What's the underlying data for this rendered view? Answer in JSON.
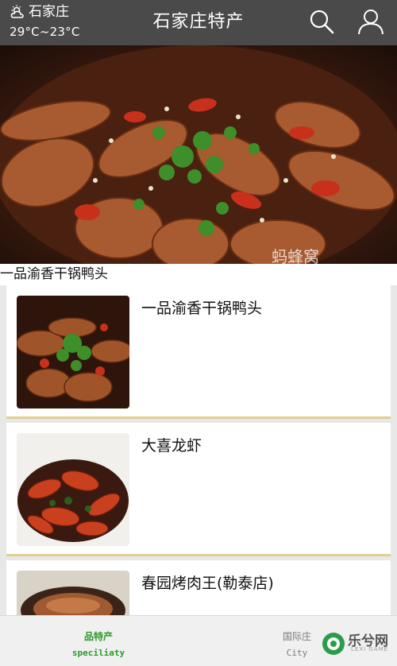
{
  "header": {
    "city": "石家庄",
    "temperature": "29°C~23°C",
    "title": "石家庄特产",
    "weather_icon": "cloud-sun-icon",
    "search_icon": "search-icon",
    "user_icon": "user-icon"
  },
  "hero": {
    "caption": "一品渝香干锅鸭头",
    "watermark": "蚂蜂窝"
  },
  "list": {
    "items": [
      {
        "name": "一品渝香干锅鸭头"
      },
      {
        "name": "大喜龙虾"
      },
      {
        "name": "春园烤肉王(勒泰店)"
      }
    ]
  },
  "bottom_nav": {
    "tabs": [
      {
        "label": "品特产",
        "sub": "speciliaty",
        "active": true
      },
      {
        "label": "国际庄",
        "sub": "City",
        "active": false
      }
    ]
  },
  "watermark": {
    "text": "乐兮网",
    "sub": "LEXI GAME"
  },
  "colors": {
    "header_bg": "#4a4a4a",
    "active_tab": "#2b9a2b",
    "divider": "#e0cf8e"
  }
}
